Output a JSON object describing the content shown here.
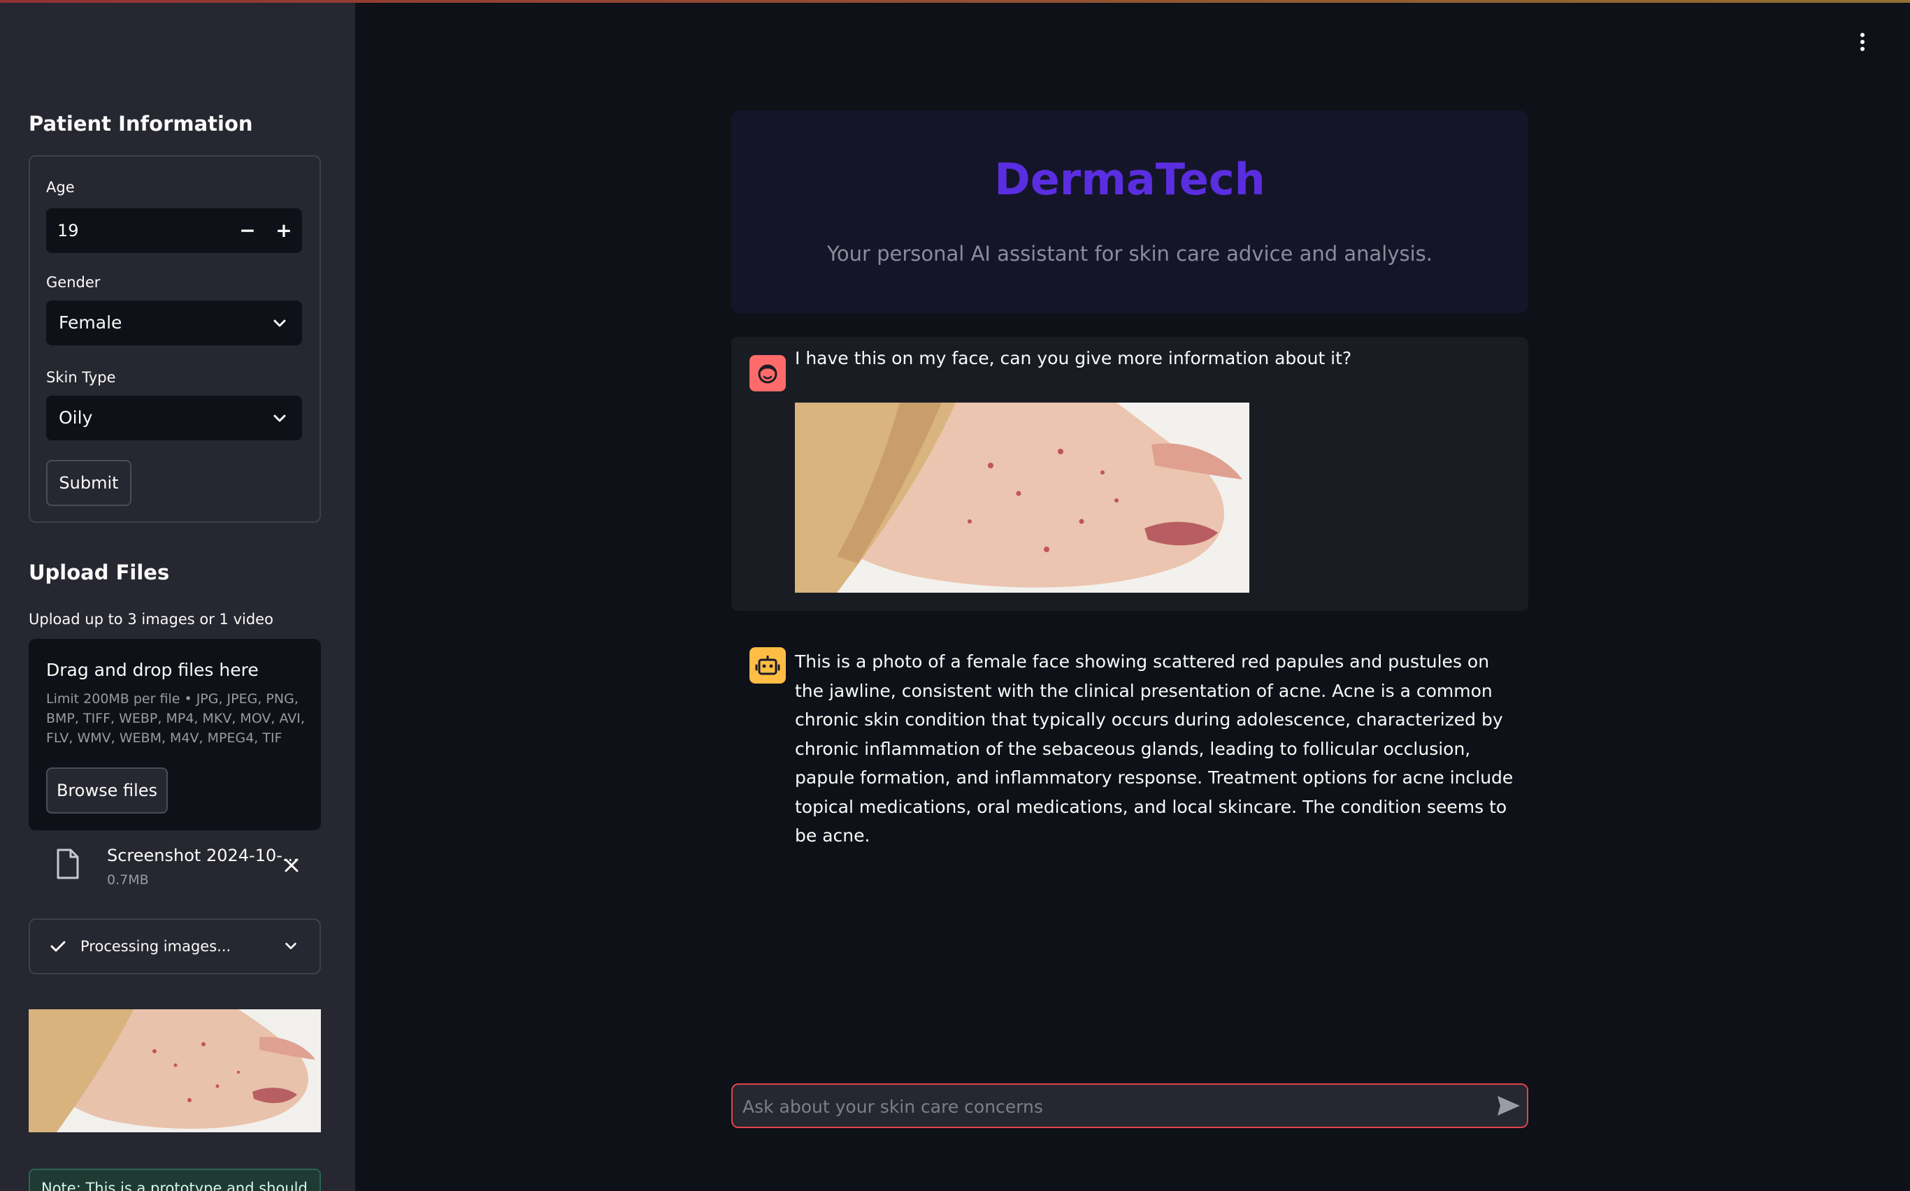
{
  "sidebar": {
    "patient_title": "Patient Information",
    "age": {
      "label": "Age",
      "value": "19",
      "minus": "−",
      "plus": "+"
    },
    "gender": {
      "label": "Gender",
      "value": "Female"
    },
    "skin_type": {
      "label": "Skin Type",
      "value": "Oily"
    },
    "submit_label": "Submit",
    "upload_title": "Upload Files",
    "upload_hint": "Upload up to 3 images or 1 video",
    "dropzone": {
      "title": "Drag and drop files here",
      "limit": "Limit 200MB per file • JPG, JPEG, PNG, BMP, TIFF, WEBP, MP4, MKV, MOV, AVI, FLV, WMV, WEBM, M4V, MPEG4, TIF",
      "browse_label": "Browse files"
    },
    "file": {
      "name": "Screenshot 2024-10-...",
      "size": "0.7MB"
    },
    "processing_label": "Processing images...",
    "note_text": "Note: This is a prototype and should..."
  },
  "header": {
    "title": "DermaTech",
    "subtitle": "Your personal AI assistant for skin care advice and analysis."
  },
  "messages": [
    {
      "role": "user",
      "text": "I have this on my face, can you give more information about it?"
    },
    {
      "role": "assistant",
      "text": "This is a photo of a female face showing scattered red papules and pustules on the jawline, consistent with the clinical presentation of acne. Acne is a common chronic skin condition that typically occurs during adolescence, characterized by chronic inflammation of the sebaceous glands, leading to follicular occlusion, papule formation, and inflammatory response. Treatment options for acne include topical medications, oral medications, and local skincare. The condition seems to be acne."
    }
  ],
  "chat_input": {
    "placeholder": "Ask about your skin care concerns"
  },
  "colors": {
    "accent": "#5a2ee0",
    "user_avatar": "#ff6b6b",
    "bot_avatar": "#ffbd45",
    "input_border": "#e0434c"
  }
}
